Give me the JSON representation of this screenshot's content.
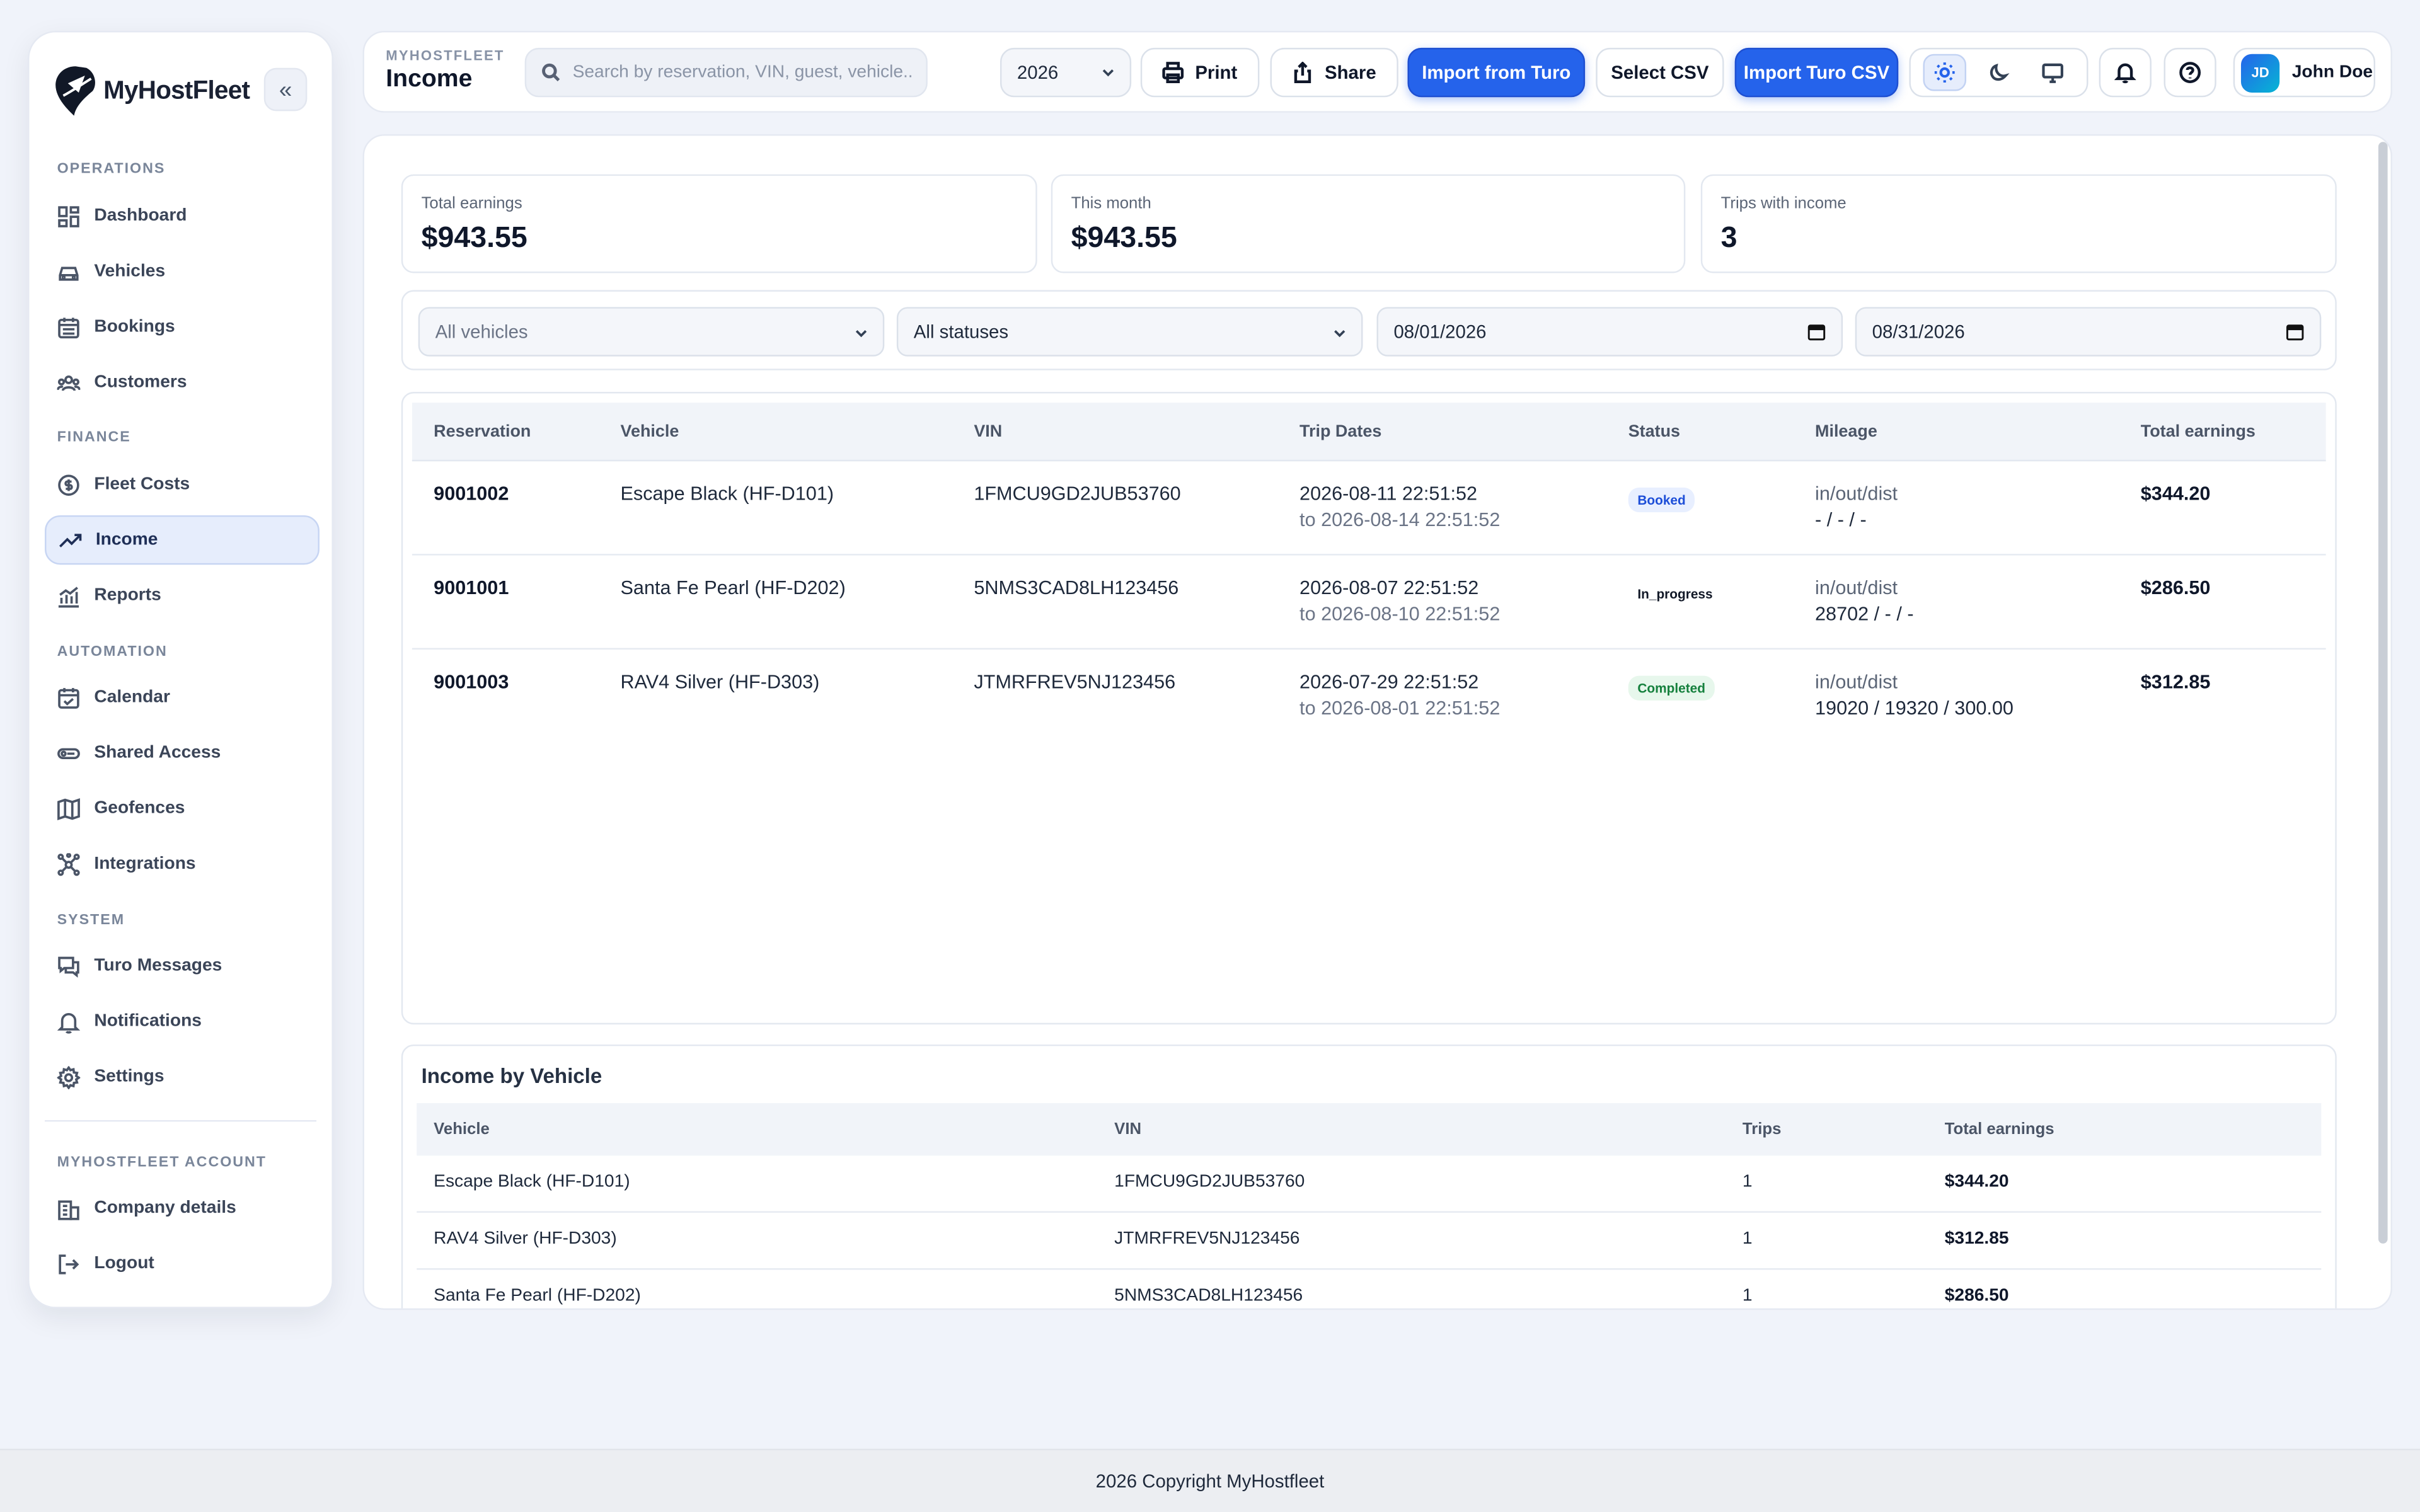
{
  "brand": {
    "name": "MyHostFleet"
  },
  "sidebar": {
    "sections": [
      {
        "label": "OPERATIONS"
      },
      {
        "label": "FINANCE"
      },
      {
        "label": "AUTOMATION"
      },
      {
        "label": "SYSTEM"
      },
      {
        "label": "MYHOSTFLEET ACCOUNT"
      }
    ],
    "items": [
      {
        "label": "Dashboard",
        "icon": "dashboard-icon"
      },
      {
        "label": "Vehicles",
        "icon": "car-icon"
      },
      {
        "label": "Bookings",
        "icon": "calendar-grid-icon"
      },
      {
        "label": "Customers",
        "icon": "users-icon"
      },
      {
        "label": "Fleet Costs",
        "icon": "dollar-circle-icon"
      },
      {
        "label": "Income",
        "icon": "trend-up-icon",
        "active": true
      },
      {
        "label": "Reports",
        "icon": "chart-icon"
      },
      {
        "label": "Calendar",
        "icon": "calendar-check-icon"
      },
      {
        "label": "Shared Access",
        "icon": "key-icon"
      },
      {
        "label": "Geofences",
        "icon": "map-icon"
      },
      {
        "label": "Integrations",
        "icon": "network-icon"
      },
      {
        "label": "Turo Messages",
        "icon": "messages-icon"
      },
      {
        "label": "Notifications",
        "icon": "bell-icon"
      },
      {
        "label": "Settings",
        "icon": "gear-icon"
      },
      {
        "label": "Company details",
        "icon": "building-icon"
      },
      {
        "label": "Logout",
        "icon": "logout-icon"
      }
    ]
  },
  "header": {
    "crumb": "MYHOSTFLEET",
    "title": "Income",
    "search_placeholder": "Search by reservation, VIN, guest, vehicle...",
    "year": "2026",
    "print_label": "Print",
    "share_label": "Share",
    "import_turo_label": "Import from Turo",
    "select_csv_label": "Select CSV",
    "import_csv_label": "Import Turo CSV",
    "user_initials": "JD",
    "user_name": "John Doe"
  },
  "stats": [
    {
      "label": "Total earnings",
      "value": "$943.55"
    },
    {
      "label": "This month",
      "value": "$943.55"
    },
    {
      "label": "Trips with income",
      "value": "3"
    }
  ],
  "filters": {
    "vehicle": "All vehicles",
    "status": "All statuses",
    "date_from": "08/01/2026",
    "date_to": "08/31/2026"
  },
  "table": {
    "columns": [
      "Reservation",
      "Vehicle",
      "VIN",
      "Trip Dates",
      "Status",
      "Mileage",
      "Total earnings"
    ],
    "rows": [
      {
        "reservation": "9001002",
        "vehicle": "Escape Black (HF-D101)",
        "vin": "1FMCU9GD2JUB53760",
        "start": "2026-08-11 22:51:52",
        "end": "to 2026-08-14 22:51:52",
        "status": "Booked",
        "status_color": "#1d4ed8",
        "status_bg": "#e8efff",
        "mileage_label": "in/out/dist",
        "mileage": "- / - / -",
        "earnings": "$344.20"
      },
      {
        "reservation": "9001001",
        "vehicle": "Santa Fe Pearl (HF-D202)",
        "vin": "5NMS3CAD8LH123456",
        "start": "2026-08-07 22:51:52",
        "end": "to 2026-08-10 22:51:52",
        "status": "In_progress",
        "status_color": "#111827",
        "status_bg": "#ffffff",
        "mileage_label": "in/out/dist",
        "mileage": "28702 / - / -",
        "earnings": "$286.50"
      },
      {
        "reservation": "9001003",
        "vehicle": "RAV4 Silver (HF-D303)",
        "vin": "JTMRFREV5NJ123456",
        "start": "2026-07-29 22:51:52",
        "end": "to 2026-08-01 22:51:52",
        "status": "Completed",
        "status_color": "#15803d",
        "status_bg": "#e7f7ec",
        "mileage_label": "in/out/dist",
        "mileage": "19020 / 19320 / 300.00",
        "earnings": "$312.85"
      }
    ]
  },
  "by_vehicle": {
    "title": "Income by Vehicle",
    "columns": [
      "Vehicle",
      "VIN",
      "Trips",
      "Total earnings"
    ],
    "rows": [
      {
        "vehicle": "Escape Black (HF-D101)",
        "vin": "1FMCU9GD2JUB53760",
        "trips": "1",
        "earnings": "$344.20"
      },
      {
        "vehicle": "RAV4 Silver (HF-D303)",
        "vin": "JTMRFREV5NJ123456",
        "trips": "1",
        "earnings": "$312.85"
      },
      {
        "vehicle": "Santa Fe Pearl (HF-D202)",
        "vin": "5NMS3CAD8LH123456",
        "trips": "1",
        "earnings": "$286.50"
      }
    ]
  },
  "footer": {
    "text": "2026 Copyright MyHostfleet"
  }
}
